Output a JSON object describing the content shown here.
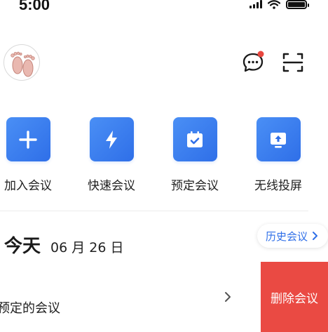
{
  "status_bar": {
    "time": "5:00"
  },
  "quick_actions": [
    {
      "label": "加入会议",
      "icon": "plus-icon"
    },
    {
      "label": "快速会议",
      "icon": "lightning-icon"
    },
    {
      "label": "预定会议",
      "icon": "calendar-check-icon"
    },
    {
      "label": "无线投屏",
      "icon": "screen-cast-icon"
    }
  ],
  "today": {
    "label": "今天",
    "date": "06 月 26 日"
  },
  "history_button": {
    "label": "历史会议"
  },
  "meeting_row": {
    "title": "预定的会议"
  },
  "delete_button": {
    "label": "删除会议"
  },
  "colors": {
    "accent": "#2f6fe8",
    "danger": "#ea4a43",
    "badge": "#e8473f"
  }
}
